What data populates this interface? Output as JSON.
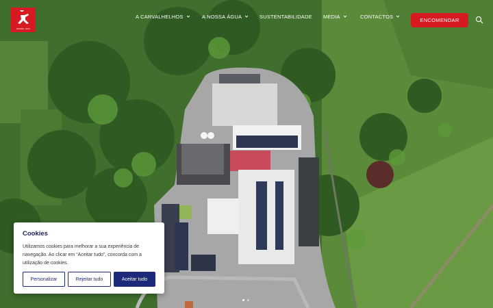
{
  "brand": {
    "logo_caption": "DESDE 1929",
    "accent_color": "#d71a21"
  },
  "nav": {
    "items": [
      {
        "label": "A Carvalhelhos",
        "has_dropdown": true
      },
      {
        "label": "A Nossa Água",
        "has_dropdown": true
      },
      {
        "label": "Sustentabilidade",
        "has_dropdown": false
      },
      {
        "label": "Media",
        "has_dropdown": true
      },
      {
        "label": "Contactos",
        "has_dropdown": true
      }
    ],
    "order_label": "ENCOMENDAR",
    "search_icon": "search-icon"
  },
  "hero": {
    "image": "aerial view of bottling plant surrounded by forest and fields",
    "slides_total": 2,
    "slide_active": 1
  },
  "cookie": {
    "title": "Cookies",
    "text": "Utilizamos cookies para melhorar a sua experiência de navegação. Ao clicar em “Aceitar tudo”, concorda com a utilização de cookies.",
    "buttons": {
      "customize": "Personalizar",
      "reject": "Rejeitar tudo",
      "accept": "Aceitar tudo"
    },
    "button_color": "#1d2a7a",
    "title_color": "#1d1f4f"
  }
}
